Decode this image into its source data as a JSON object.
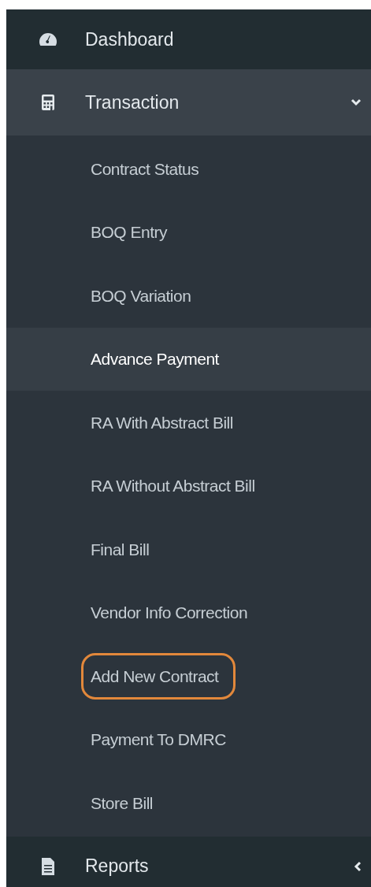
{
  "menu": [
    {
      "kind": "link",
      "label": "Dashboard"
    },
    {
      "kind": "group",
      "label": "Transaction",
      "expanded": true,
      "children": [
        {
          "label": "Contract Status",
          "selected": false,
          "circled": false
        },
        {
          "label": "BOQ Entry",
          "selected": false,
          "circled": false
        },
        {
          "label": "BOQ Variation",
          "selected": false,
          "circled": false
        },
        {
          "label": "Advance Payment",
          "selected": true,
          "circled": false
        },
        {
          "label": "RA With Abstract Bill",
          "selected": false,
          "circled": false
        },
        {
          "label": "RA Without Abstract Bill",
          "selected": false,
          "circled": false
        },
        {
          "label": "Final Bill",
          "selected": false,
          "circled": false
        },
        {
          "label": "Vendor Info Correction",
          "selected": false,
          "circled": false
        },
        {
          "label": "Add New Contract",
          "selected": false,
          "circled": true
        },
        {
          "label": "Payment To DMRC",
          "selected": false,
          "circled": false
        },
        {
          "label": "Store Bill",
          "selected": false,
          "circled": false
        }
      ]
    },
    {
      "kind": "group",
      "label": "Reports",
      "expanded": false
    }
  ]
}
